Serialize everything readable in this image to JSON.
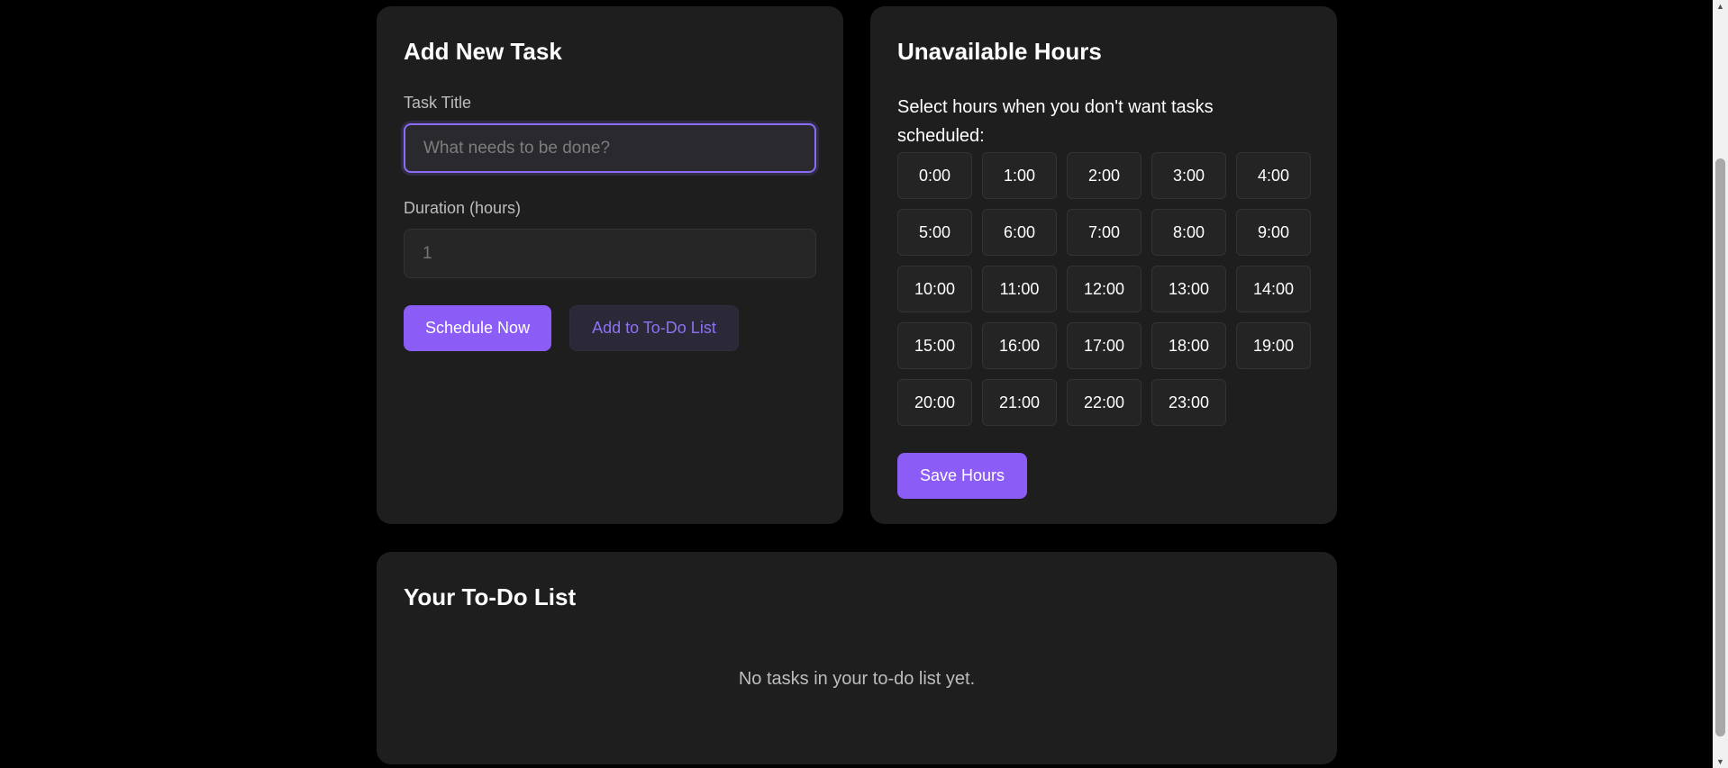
{
  "add_task": {
    "heading": "Add New Task",
    "title_label": "Task Title",
    "title_value": "",
    "title_placeholder": "What needs to be done?",
    "duration_label": "Duration (hours)",
    "duration_value": "",
    "duration_placeholder": "1",
    "schedule_button": "Schedule Now",
    "todo_button": "Add to To-Do List"
  },
  "unavailable_hours": {
    "heading": "Unavailable Hours",
    "intro": "Select hours when you don't want tasks scheduled:",
    "hours": [
      "0:00",
      "1:00",
      "2:00",
      "3:00",
      "4:00",
      "5:00",
      "6:00",
      "7:00",
      "8:00",
      "9:00",
      "10:00",
      "11:00",
      "12:00",
      "13:00",
      "14:00",
      "15:00",
      "16:00",
      "17:00",
      "18:00",
      "19:00",
      "20:00",
      "21:00",
      "22:00",
      "23:00"
    ],
    "save_button": "Save Hours"
  },
  "todo_list": {
    "heading": "Your To-Do List",
    "empty_message": "No tasks in your to-do list yet."
  },
  "scrollbar": {
    "up_icon": "triangle-up-icon",
    "down_icon": "triangle-down-icon",
    "up_glyph": "▲",
    "down_glyph": "▼"
  },
  "colors": {
    "background": "#000000",
    "card": "#1e1e1e",
    "accent": "#8b5cf6",
    "secondary_button_text": "#8f72f4",
    "muted_text": "#bdbdbd"
  }
}
